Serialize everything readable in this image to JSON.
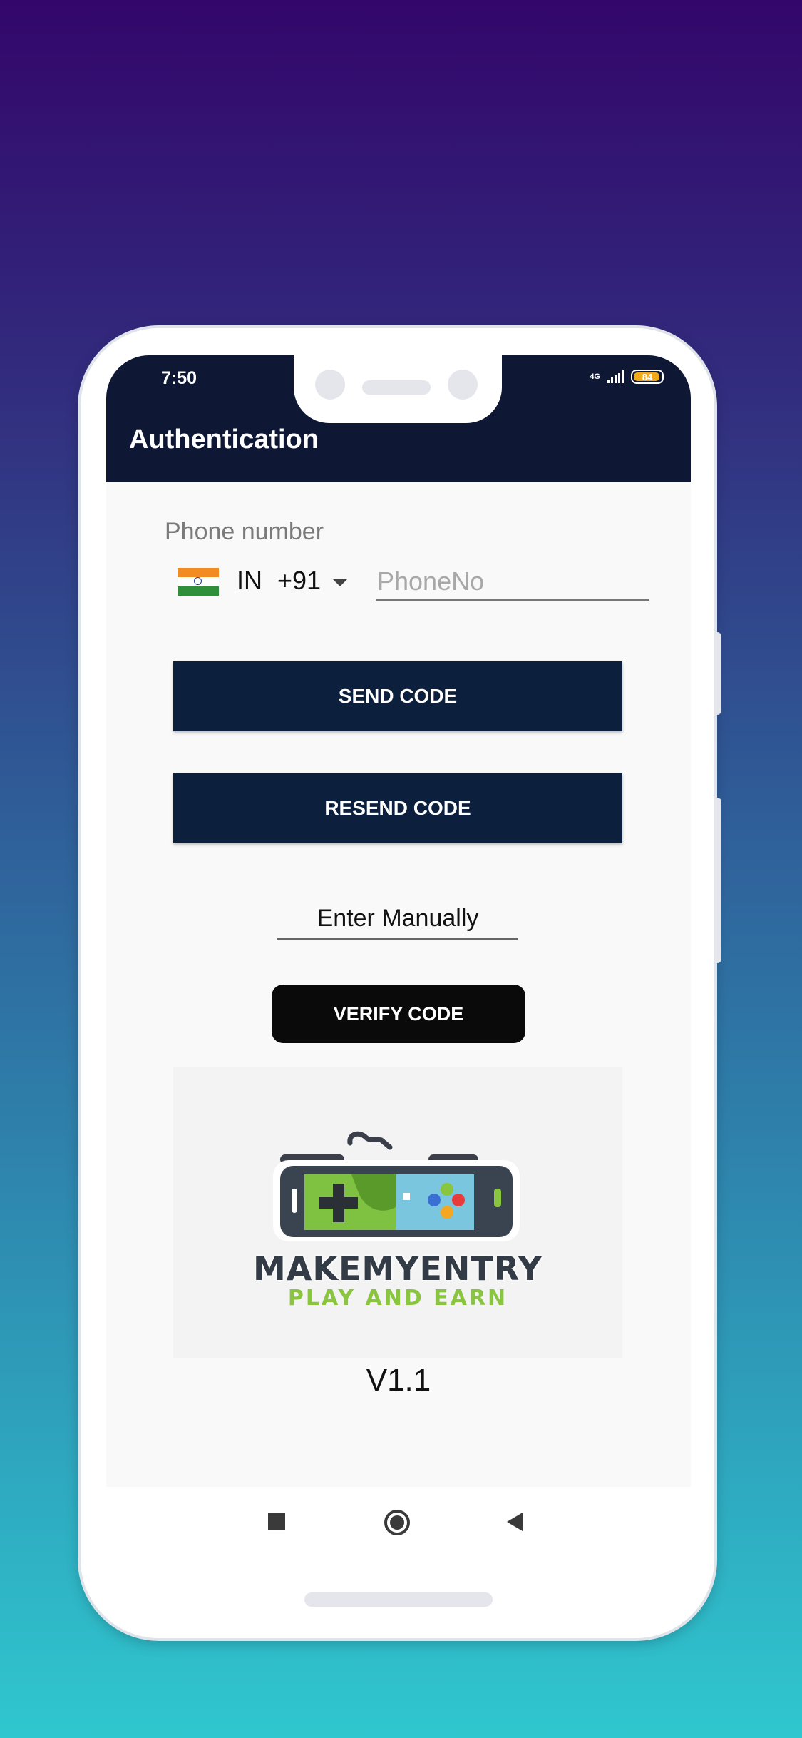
{
  "status_bar": {
    "time": "7:50",
    "network": "4G",
    "battery": "84"
  },
  "app_bar": {
    "title": "Authentication"
  },
  "form": {
    "phone_label": "Phone number",
    "country_code": "IN",
    "dial_code": "+91",
    "phone_placeholder": "PhoneNo",
    "phone_value": ""
  },
  "buttons": {
    "send_code": "SEND CODE",
    "resend_code": "RESEND CODE",
    "enter_manually": "Enter Manually",
    "verify_code": "VERIFY CODE"
  },
  "logo": {
    "title": "MAKEMYENTRY",
    "subtitle": "PLAY AND EARN"
  },
  "version": "V1.1",
  "nav": {
    "recents_icon": "square-icon",
    "home_icon": "circle-icon",
    "back_icon": "triangle-back-icon"
  },
  "colors": {
    "app_bar": "#0e1733",
    "primary_button": "#0c1f3d",
    "verify_button": "#0a0a0a",
    "logo_green": "#8ac53f"
  }
}
